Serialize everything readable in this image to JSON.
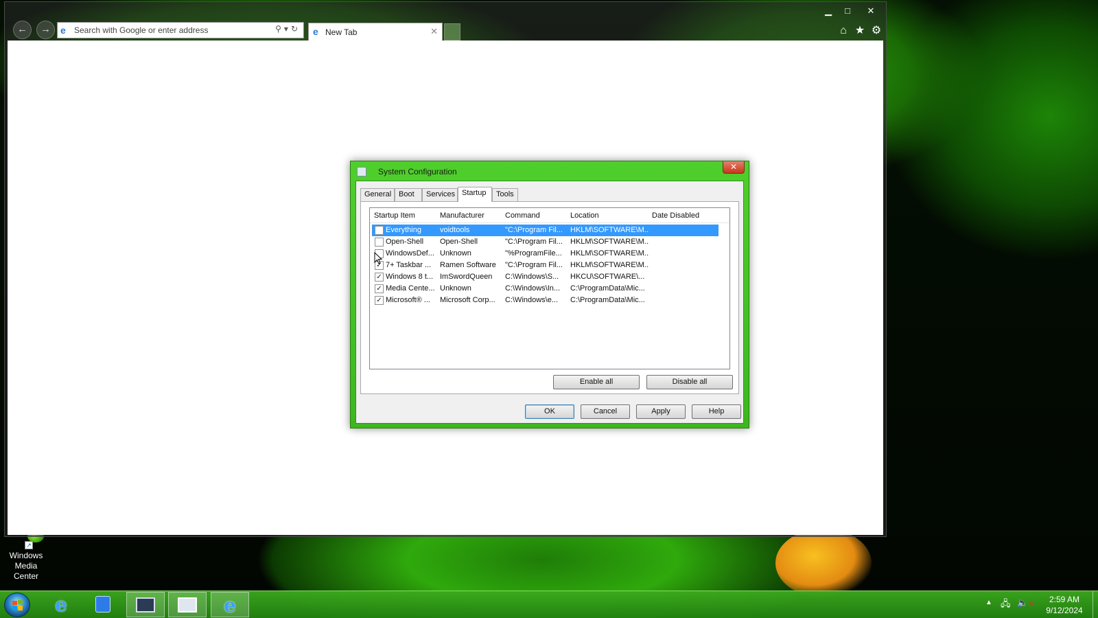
{
  "browser": {
    "address_placeholder": "Search with Google or enter address",
    "tab_title": "New Tab",
    "icons": [
      "back-icon",
      "forward-icon",
      "ie-icon",
      "search-icon",
      "refresh-icon",
      "home-icon",
      "star-icon",
      "gear-icon"
    ]
  },
  "desktop": {
    "icon_label_line1": "Windows",
    "icon_label_line2": "Media Center"
  },
  "dialog": {
    "title": "System Configuration",
    "tabs": [
      "General",
      "Boot",
      "Services",
      "Startup",
      "Tools"
    ],
    "active_tab": "Startup",
    "columns": [
      "Startup Item",
      "Manufacturer",
      "Command",
      "Location",
      "Date Disabled"
    ],
    "rows": [
      {
        "checked": false,
        "selected": true,
        "item": "Everything",
        "manufacturer": "voidtools",
        "command": "\"C:\\Program Fil...",
        "location": "HKLM\\SOFTWARE\\M...",
        "date_disabled": ""
      },
      {
        "checked": false,
        "selected": false,
        "item": "Open-Shell",
        "manufacturer": "Open-Shell",
        "command": "\"C:\\Program Fil...",
        "location": "HKLM\\SOFTWARE\\M...",
        "date_disabled": ""
      },
      {
        "checked": false,
        "selected": false,
        "item": "WindowsDef...",
        "manufacturer": "Unknown",
        "command": "\"%ProgramFile...",
        "location": "HKLM\\SOFTWARE\\M...",
        "date_disabled": ""
      },
      {
        "checked": true,
        "selected": false,
        "item": "7+ Taskbar ...",
        "manufacturer": "Ramen Software",
        "command": "\"C:\\Program Fil...",
        "location": "HKLM\\SOFTWARE\\M...",
        "date_disabled": ""
      },
      {
        "checked": true,
        "selected": false,
        "item": "Windows 8 t...",
        "manufacturer": "ImSwordQueen",
        "command": "C:\\Windows\\S...",
        "location": "HKCU\\SOFTWARE\\...",
        "date_disabled": ""
      },
      {
        "checked": true,
        "selected": false,
        "item": "Media Cente...",
        "manufacturer": "Unknown",
        "command": "C:\\Windows\\In...",
        "location": "C:\\ProgramData\\Mic...",
        "date_disabled": ""
      },
      {
        "checked": true,
        "selected": false,
        "item": "Microsoft® ...",
        "manufacturer": "Microsoft Corp...",
        "command": "C:\\Windows\\e...",
        "location": "C:\\ProgramData\\Mic...",
        "date_disabled": ""
      }
    ],
    "buttons": {
      "enable_all": "Enable all",
      "disable_all": "Disable all",
      "ok": "OK",
      "cancel": "Cancel",
      "apply": "Apply",
      "help": "Help"
    }
  },
  "taskbar": {
    "clock_time": "2:59 AM",
    "clock_date": "9/12/2024",
    "items": [
      "internet-explorer",
      "store",
      "task-manager",
      "system-configuration",
      "internet-explorer"
    ]
  },
  "colors": {
    "accent_green": "#3cb81e",
    "selection_blue": "#3399ff"
  }
}
